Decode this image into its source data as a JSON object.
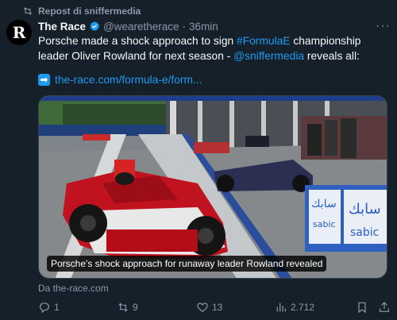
{
  "repost": {
    "label": "Repost di sniffermedia"
  },
  "author": {
    "avatar_letter": "R",
    "name": "The Race",
    "handle": "@wearetherace",
    "separator": "·",
    "time": "36min"
  },
  "tweet": {
    "part1": "Porsche made a shock approach to sign ",
    "hashtag": "#FormulaE",
    "part2": " championship leader Oliver Rowland for next season - ",
    "mention": "@sniffermedia",
    "part3": " reveals all:",
    "url_arrow": "➡",
    "url": "the-race.com/formula-e/form..."
  },
  "card": {
    "caption": "Porsche's shock approach for runaway leader Rowland revealed",
    "source": "Da the-race.com",
    "banner_text_1": "سابك",
    "banner_text_2": "sabic"
  },
  "actions": {
    "replies": "1",
    "reposts": "9",
    "likes": "13",
    "views": "2.712"
  },
  "colors": {
    "background": "#15202b",
    "accent": "#1d9bf0",
    "muted": "#8b98a5",
    "repost_green": "#00ba7c"
  },
  "icons": [
    "repost-icon",
    "verified-icon",
    "more-icon",
    "reply-icon",
    "like-icon",
    "views-icon",
    "bookmark-icon",
    "share-icon"
  ]
}
